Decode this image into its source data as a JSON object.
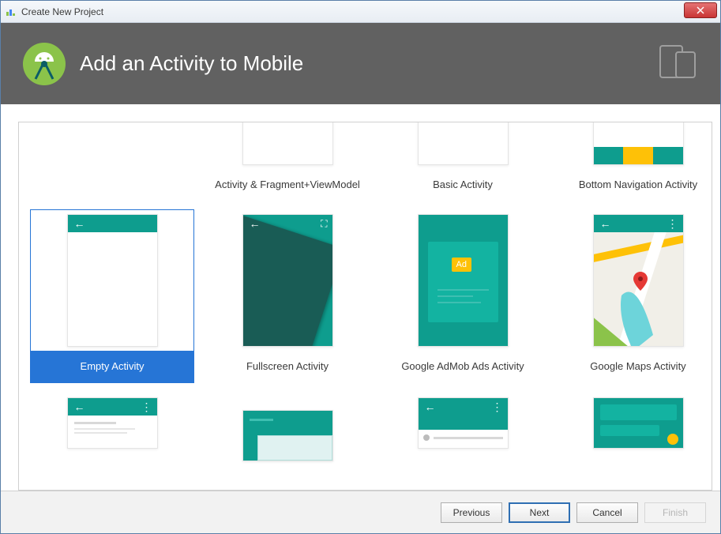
{
  "window": {
    "title": "Create New Project"
  },
  "header": {
    "title": "Add an Activity to Mobile"
  },
  "templates": [
    {
      "label": "",
      "type": "placeholder"
    },
    {
      "label": "Activity & Fragment+ViewModel",
      "type": "vm"
    },
    {
      "label": "Basic Activity",
      "type": "basic"
    },
    {
      "label": "Bottom Navigation Activity",
      "type": "bottomnav"
    },
    {
      "label": "Empty Activity",
      "type": "empty",
      "selected": true
    },
    {
      "label": "Fullscreen Activity",
      "type": "fullscreen"
    },
    {
      "label": "Google AdMob Ads Activity",
      "type": "admob"
    },
    {
      "label": "Google Maps Activity",
      "type": "maps"
    }
  ],
  "buttons": {
    "previous": "Previous",
    "next": "Next",
    "cancel": "Cancel",
    "finish": "Finish"
  },
  "ad_text": "Ad"
}
